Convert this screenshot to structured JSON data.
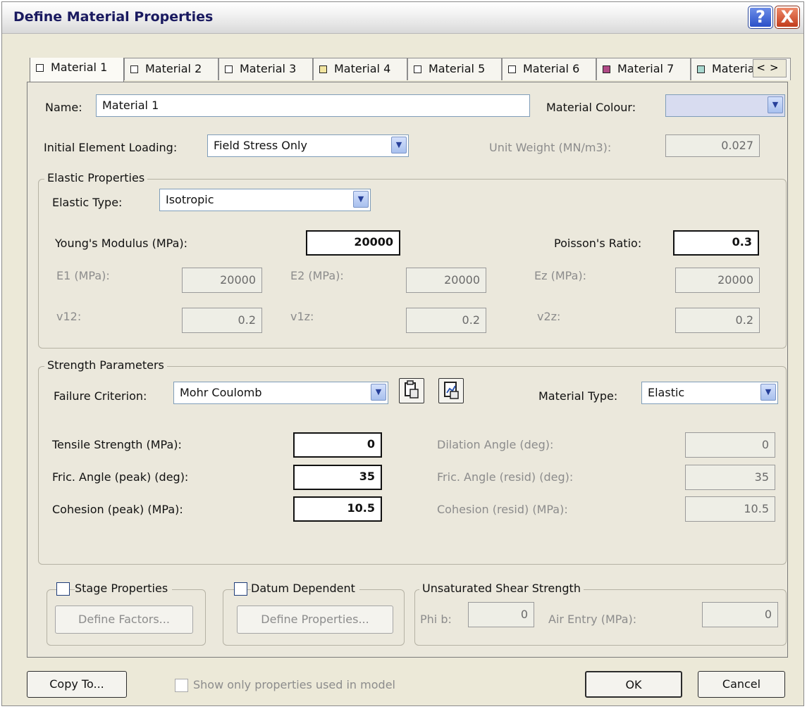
{
  "window": {
    "title": "Define Material Properties",
    "help_glyph": "?",
    "close_glyph": "X"
  },
  "tabs": [
    {
      "label": "Material 1",
      "swatch": "#ffffff"
    },
    {
      "label": "Material 2",
      "swatch": "#ffffff"
    },
    {
      "label": "Material 3",
      "swatch": "#ffffff"
    },
    {
      "label": "Material 4",
      "swatch": "#f2e5a0"
    },
    {
      "label": "Material 5",
      "swatch": "#ffffff"
    },
    {
      "label": "Material 6",
      "swatch": "#ffffff"
    },
    {
      "label": "Material 7",
      "swatch": "#b04a86"
    },
    {
      "label": "Materia",
      "swatch": "#a8d8cf"
    }
  ],
  "tab_scroll": "<>",
  "name": {
    "label": "Name:",
    "value": "Material 1"
  },
  "colour": {
    "label": "Material Colour:",
    "swatch": "#d8dcf0"
  },
  "loading": {
    "label": "Initial Element Loading:",
    "value": "Field Stress Only"
  },
  "unit_weight": {
    "label": "Unit Weight (MN/m3):",
    "value": "0.027"
  },
  "elastic": {
    "title": "Elastic Properties",
    "type_label": "Elastic Type:",
    "type_value": "Isotropic",
    "youngs_label": "Young's Modulus (MPa):",
    "youngs_value": "20000",
    "poisson_label": "Poisson's Ratio:",
    "poisson_value": "0.3",
    "e1_label": "E1 (MPa):",
    "e1_value": "20000",
    "e2_label": "E2 (MPa):",
    "e2_value": "20000",
    "ez_label": "Ez (MPa):",
    "ez_value": "20000",
    "v12_label": "v12:",
    "v12_value": "0.2",
    "v1z_label": "v1z:",
    "v1z_value": "0.2",
    "v2z_label": "v2z:",
    "v2z_value": "0.2"
  },
  "strength": {
    "title": "Strength Parameters",
    "criterion_label": "Failure Criterion:",
    "criterion_value": "Mohr Coulomb",
    "material_type_label": "Material Type:",
    "material_type_value": "Elastic",
    "tensile_label": "Tensile Strength (MPa):",
    "tensile_value": "0",
    "fric_peak_label": "Fric. Angle (peak) (deg):",
    "fric_peak_value": "35",
    "coh_peak_label": "Cohesion (peak) (MPa):",
    "coh_peak_value": "10.5",
    "dilation_label": "Dilation Angle (deg):",
    "dilation_value": "0",
    "fric_resid_label": "Fric. Angle (resid) (deg):",
    "fric_resid_value": "35",
    "coh_resid_label": "Cohesion (resid) (MPa):",
    "coh_resid_value": "10.5"
  },
  "stage": {
    "label": "Stage Properties",
    "button": "Define Factors..."
  },
  "datum": {
    "label": "Datum Dependent",
    "button": "Define Properties..."
  },
  "unsaturated": {
    "title": "Unsaturated Shear Strength",
    "phib_label": "Phi b:",
    "phib_value": "0",
    "air_label": "Air Entry (MPa):",
    "air_value": "0"
  },
  "footer": {
    "copy_to": "Copy To...",
    "show_only": "Show only properties used in model",
    "ok": "OK",
    "cancel": "Cancel"
  }
}
